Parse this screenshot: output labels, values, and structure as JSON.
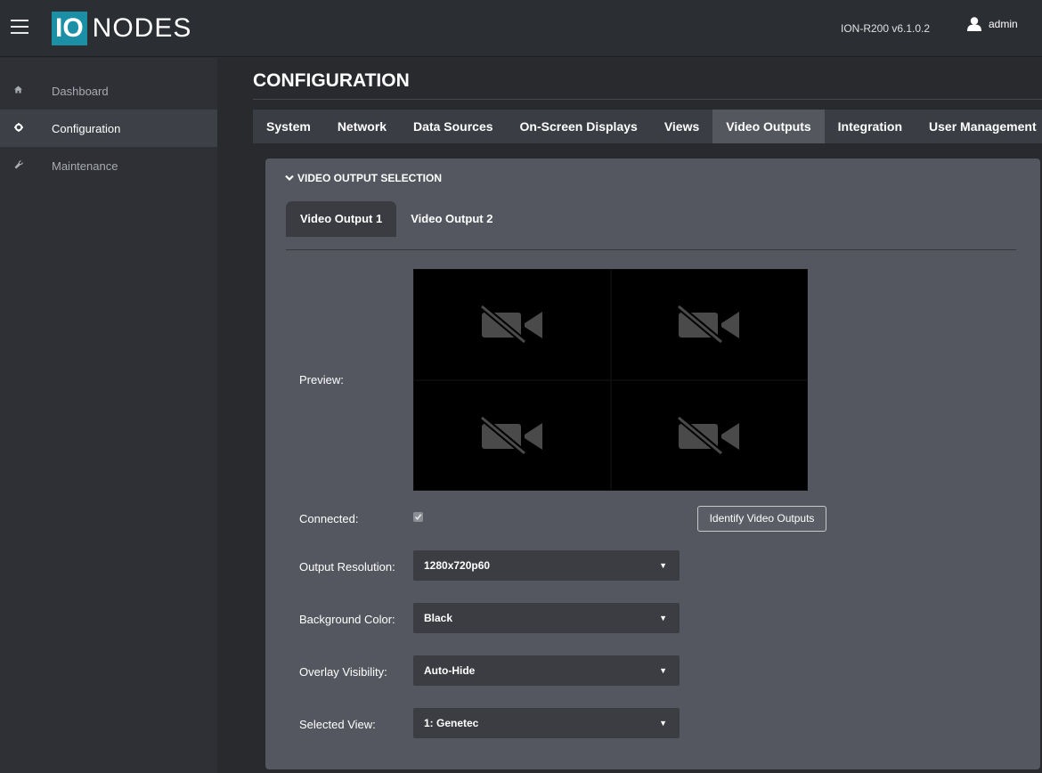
{
  "header": {
    "logo_io": "IO",
    "logo_nodes": "NODES",
    "device": "ION-R200  v6.1.0.2",
    "user": "admin"
  },
  "sidebar": {
    "items": [
      {
        "label": "Dashboard",
        "icon": "home-icon"
      },
      {
        "label": "Configuration",
        "icon": "gear-icon",
        "active": true
      },
      {
        "label": "Maintenance",
        "icon": "wrench-icon"
      }
    ]
  },
  "main": {
    "title": "CONFIGURATION",
    "tabs": [
      {
        "label": "System"
      },
      {
        "label": "Network"
      },
      {
        "label": "Data Sources"
      },
      {
        "label": "On-Screen Displays"
      },
      {
        "label": "Views"
      },
      {
        "label": "Video Outputs",
        "active": true
      },
      {
        "label": "Integration"
      },
      {
        "label": "User Management"
      }
    ]
  },
  "panel": {
    "section_title": "VIDEO OUTPUT SELECTION",
    "subtabs": [
      {
        "label": "Video Output 1",
        "active": true
      },
      {
        "label": "Video Output 2"
      }
    ],
    "preview_label": "Preview:",
    "connected_label": "Connected:",
    "connected_checked": true,
    "identify_button": "Identify Video Outputs",
    "fields": {
      "output_resolution": {
        "label": "Output Resolution:",
        "value": "1280x720p60"
      },
      "background_color": {
        "label": "Background Color:",
        "value": "Black"
      },
      "overlay_visibility": {
        "label": "Overlay Visibility:",
        "value": "Auto-Hide"
      },
      "selected_view": {
        "label": "Selected View:",
        "value": "1: Genetec"
      }
    }
  },
  "colors": {
    "accent": "#1a8fa6",
    "topbar": "#2b2e33",
    "panel": "#54575f",
    "select": "#3b3d43"
  }
}
